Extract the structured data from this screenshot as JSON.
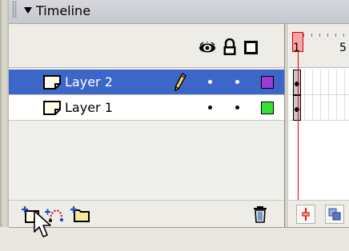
{
  "panel": {
    "title": "Timeline"
  },
  "layers": [
    {
      "name": "Layer 2",
      "selected": true,
      "color": "#9b3bd8",
      "editing": true
    },
    {
      "name": "Layer 1",
      "selected": false,
      "color": "#33e233",
      "editing": false
    }
  ],
  "ruler": {
    "frame_labels": [
      "1",
      "5"
    ]
  },
  "icons": {
    "eye": "eye-icon",
    "lock": "lock-icon",
    "outline": "outline-icon",
    "insert_layer": "insert-layer-icon",
    "motion_guide": "add-motion-guide-icon",
    "folder": "insert-folder-icon",
    "trash": "trash-icon"
  },
  "colors": {
    "selection": "#3c67c8",
    "playhead": "#f6a4a4",
    "playhead_line": "#e10000"
  }
}
